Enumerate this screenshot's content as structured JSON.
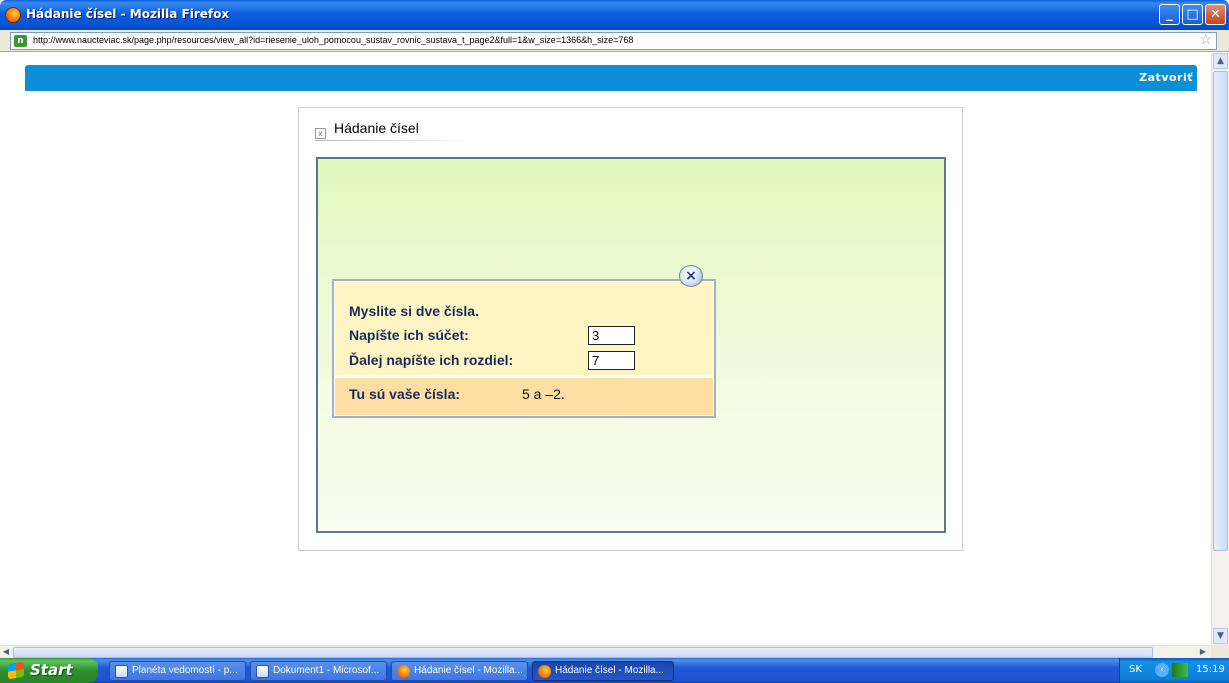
{
  "window": {
    "title": "Hádanie čísel - Mozilla Firefox",
    "controls": {
      "minimize": "_",
      "maximize": "□",
      "close": "✕"
    }
  },
  "address_bar": {
    "site_icon_letter": "n",
    "url": "http://www.naucteviac.sk/page.php/resources/view_all?id=riesenie_uloh_pomocou_sustav_rovnic_sustava_t_page2&full=1&w_size=1366&h_size=768",
    "bookmark_icon": "☆"
  },
  "page": {
    "close_link": "Zatvoriť",
    "panel": {
      "title": "Hádanie čísel",
      "header_icon": "x"
    },
    "dialog": {
      "line1": "Myslite si dve čísla.",
      "sum_label": "Napíšte ich súčet:",
      "sum_value": "3",
      "diff_label": "Ďalej napíšte ich rozdiel:",
      "diff_value": "7",
      "result_label": "Tu sú vaše čísla:",
      "result_value": "5 a –2.",
      "close_button": "×"
    }
  },
  "scrollbars": {
    "up": "▲",
    "down": "▼",
    "left": "◀",
    "right": "▶"
  },
  "taskbar": {
    "start_label": "Start",
    "tasks": [
      {
        "label": "Planéta vedomostí - p...",
        "icon": "document-icon",
        "active": false
      },
      {
        "label": "Dokument1 - Microsof...",
        "icon": "document-icon",
        "active": false
      },
      {
        "label": "Hádanie čísel - Mozilla...",
        "icon": "firefox-icon",
        "active": false
      },
      {
        "label": "Hádanie čísel - Mozilla...",
        "icon": "firefox-icon",
        "active": true
      }
    ],
    "tray": {
      "language": "SK",
      "time": "15:19"
    }
  },
  "colors": {
    "accent_bar": "#0b8fd6",
    "stage_border": "#5b7699",
    "dialog_top": "#fff4c4",
    "dialog_bottom": "#ffdea3"
  }
}
